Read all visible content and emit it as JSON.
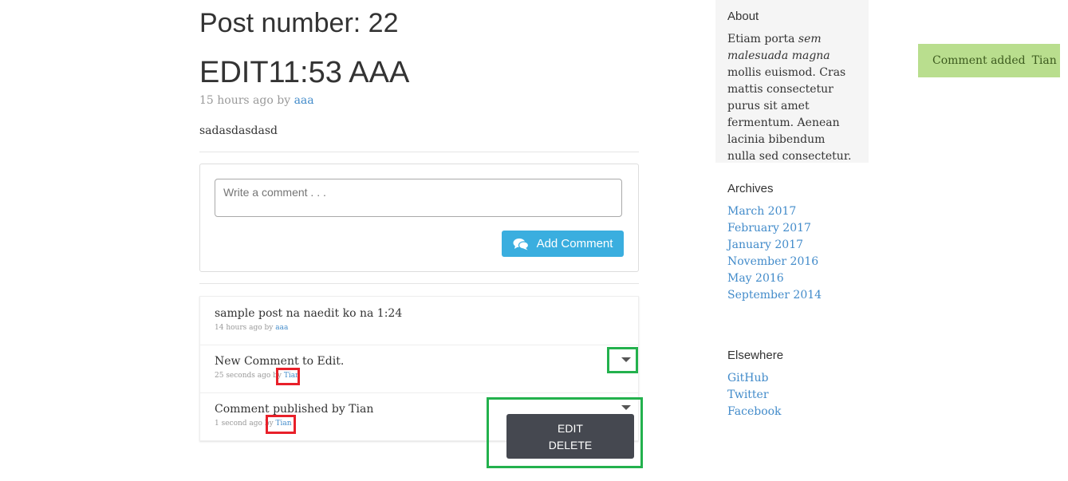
{
  "post": {
    "number_heading": "Post number: 22",
    "title": "EDIT11:53 AAA",
    "time": "15 hours ago by",
    "author": "aaa",
    "body": "sadasdasdasd"
  },
  "comment_form": {
    "placeholder": "Write a comment . . .",
    "add_button_label": "Add Comment"
  },
  "comments": [
    {
      "text": "sample post na naedit ko na 1:24",
      "time": "14 hours ago by",
      "author": "aaa"
    },
    {
      "text": "New Comment to Edit.",
      "time": "25 seconds ago by",
      "author": "Tian"
    },
    {
      "text": "Comment published by Tian",
      "time": "1 second ago by",
      "author": "Tian"
    }
  ],
  "comment_menu": {
    "edit_label": "EDIT",
    "delete_label": "DELETE"
  },
  "sidebar": {
    "about_title": "About",
    "about_text_1": "Etiam porta ",
    "about_text_em": "sem malesuada magna",
    "about_text_2": " mollis euismod. Cras mattis consectetur purus sit amet fermentum. Aenean lacinia bibendum nulla sed consectetur.",
    "archives_title": "Archives",
    "archives": [
      "March 2017",
      "February 2017",
      "January 2017",
      "November 2016",
      "May 2016",
      "September 2014"
    ],
    "elsewhere_title": "Elsewhere",
    "elsewhere": [
      "GitHub",
      "Twitter",
      "Facebook"
    ]
  },
  "toast": {
    "message": "Comment added",
    "user": "Tian"
  },
  "colors": {
    "accent": "#3aaedf",
    "link": "#428bca",
    "toast_bg": "#b9de8e",
    "menu_bg": "#454850",
    "highlight_red": "#e8202a",
    "highlight_green": "#23b14d"
  }
}
